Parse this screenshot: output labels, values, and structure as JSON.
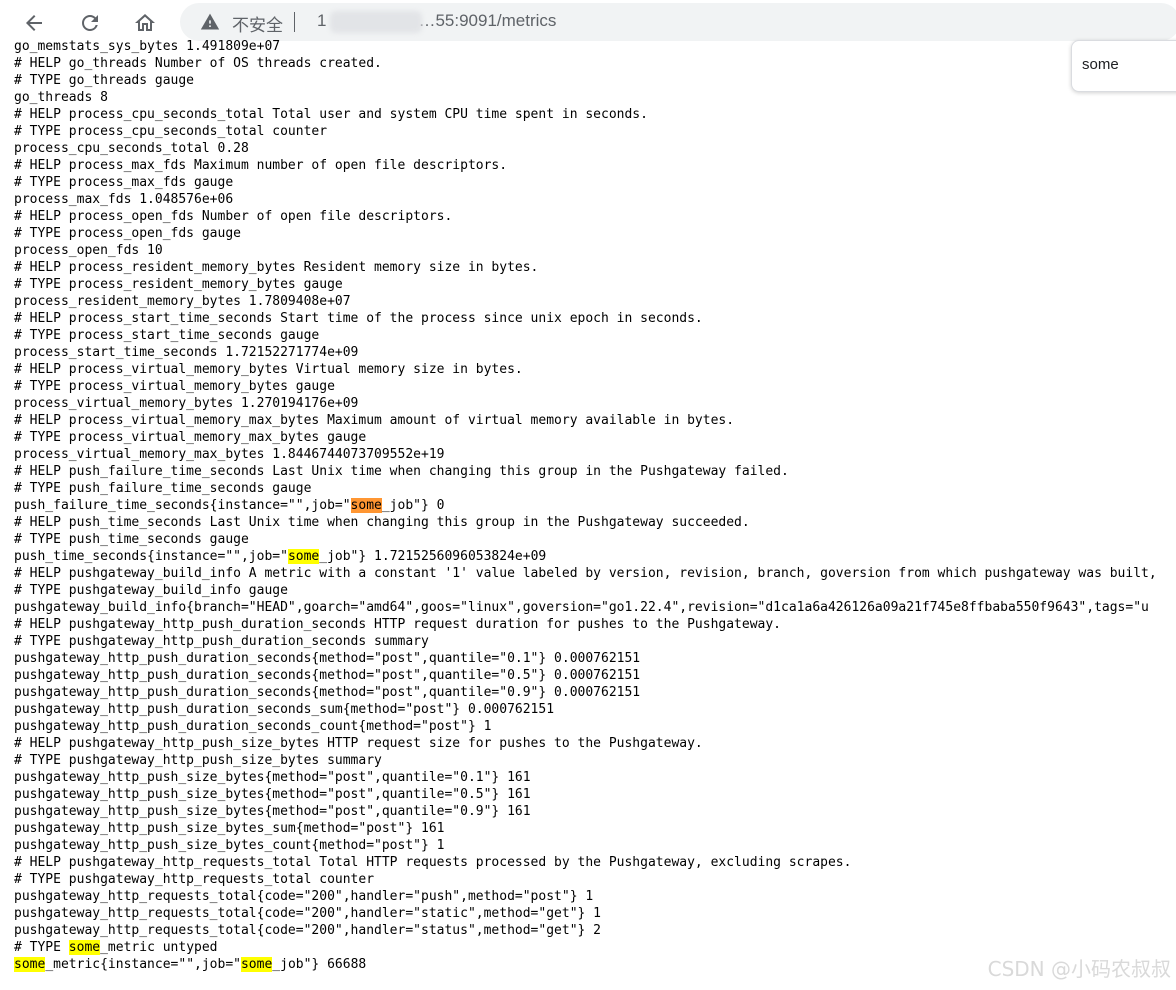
{
  "browser": {
    "security_label": "不安全",
    "url_prefix": "1",
    "url_suffix": "…55:9091/metrics",
    "icons": {
      "back": "arrow-left-icon",
      "reload": "reload-icon",
      "home": "home-icon",
      "warning": "warning-triangle-icon"
    }
  },
  "find_bar": {
    "query": "some"
  },
  "highlight_colors": {
    "match": "#ffff00",
    "active_match": "#ff9632"
  },
  "metrics_lines": [
    "go_memstats_sys_bytes 1.491809e+07",
    "# HELP go_threads Number of OS threads created.",
    "# TYPE go_threads gauge",
    "go_threads 8",
    "# HELP process_cpu_seconds_total Total user and system CPU time spent in seconds.",
    "# TYPE process_cpu_seconds_total counter",
    "process_cpu_seconds_total 0.28",
    "# HELP process_max_fds Maximum number of open file descriptors.",
    "# TYPE process_max_fds gauge",
    "process_max_fds 1.048576e+06",
    "# HELP process_open_fds Number of open file descriptors.",
    "# TYPE process_open_fds gauge",
    "process_open_fds 10",
    "# HELP process_resident_memory_bytes Resident memory size in bytes.",
    "# TYPE process_resident_memory_bytes gauge",
    "process_resident_memory_bytes 1.7809408e+07",
    "# HELP process_start_time_seconds Start time of the process since unix epoch in seconds.",
    "# TYPE process_start_time_seconds gauge",
    "process_start_time_seconds 1.72152271774e+09",
    "# HELP process_virtual_memory_bytes Virtual memory size in bytes.",
    "# TYPE process_virtual_memory_bytes gauge",
    "process_virtual_memory_bytes 1.270194176e+09",
    "# HELP process_virtual_memory_max_bytes Maximum amount of virtual memory available in bytes.",
    "# TYPE process_virtual_memory_max_bytes gauge",
    "process_virtual_memory_max_bytes 1.8446744073709552e+19",
    "# HELP push_failure_time_seconds Last Unix time when changing this group in the Pushgateway failed.",
    "# TYPE push_failure_time_seconds gauge",
    "push_failure_time_seconds{instance=\"\",job=\"some_job\"} 0",
    "# HELP push_time_seconds Last Unix time when changing this group in the Pushgateway succeeded.",
    "# TYPE push_time_seconds gauge",
    "push_time_seconds{instance=\"\",job=\"some_job\"} 1.7215256096053824e+09",
    "# HELP pushgateway_build_info A metric with a constant '1' value labeled by version, revision, branch, goversion from which pushgateway was built,",
    "# TYPE pushgateway_build_info gauge",
    "pushgateway_build_info{branch=\"HEAD\",goarch=\"amd64\",goos=\"linux\",goversion=\"go1.22.4\",revision=\"d1ca1a6a426126a09a21f745e8ffbaba550f9643\",tags=\"u",
    "# HELP pushgateway_http_push_duration_seconds HTTP request duration for pushes to the Pushgateway.",
    "# TYPE pushgateway_http_push_duration_seconds summary",
    "pushgateway_http_push_duration_seconds{method=\"post\",quantile=\"0.1\"} 0.000762151",
    "pushgateway_http_push_duration_seconds{method=\"post\",quantile=\"0.5\"} 0.000762151",
    "pushgateway_http_push_duration_seconds{method=\"post\",quantile=\"0.9\"} 0.000762151",
    "pushgateway_http_push_duration_seconds_sum{method=\"post\"} 0.000762151",
    "pushgateway_http_push_duration_seconds_count{method=\"post\"} 1",
    "# HELP pushgateway_http_push_size_bytes HTTP request size for pushes to the Pushgateway.",
    "# TYPE pushgateway_http_push_size_bytes summary",
    "pushgateway_http_push_size_bytes{method=\"post\",quantile=\"0.1\"} 161",
    "pushgateway_http_push_size_bytes{method=\"post\",quantile=\"0.5\"} 161",
    "pushgateway_http_push_size_bytes{method=\"post\",quantile=\"0.9\"} 161",
    "pushgateway_http_push_size_bytes_sum{method=\"post\"} 161",
    "pushgateway_http_push_size_bytes_count{method=\"post\"} 1",
    "# HELP pushgateway_http_requests_total Total HTTP requests processed by the Pushgateway, excluding scrapes.",
    "# TYPE pushgateway_http_requests_total counter",
    "pushgateway_http_requests_total{code=\"200\",handler=\"push\",method=\"post\"} 1",
    "pushgateway_http_requests_total{code=\"200\",handler=\"static\",method=\"get\"} 1",
    "pushgateway_http_requests_total{code=\"200\",handler=\"status\",method=\"get\"} 2",
    "# TYPE some_metric untyped",
    "some_metric{instance=\"\",job=\"some_job\"} 66688"
  ],
  "watermark": "CSDN @小码农叔叔"
}
